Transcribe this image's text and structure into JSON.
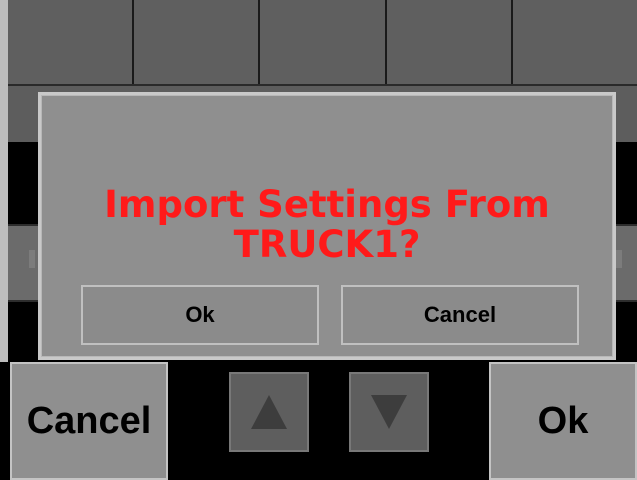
{
  "dialog": {
    "message": "Import Settings From\nTRUCK1?",
    "ok_label": "Ok",
    "cancel_label": "Cancel"
  },
  "bottom_bar": {
    "cancel_label": "Cancel",
    "ok_label": "Ok"
  },
  "icons": {
    "up": "arrow-up-icon",
    "down": "arrow-down-icon"
  },
  "colors": {
    "message": "#ff1a1a",
    "dialog_bg": "#8f8f8f",
    "screen_bg": "#000000"
  }
}
